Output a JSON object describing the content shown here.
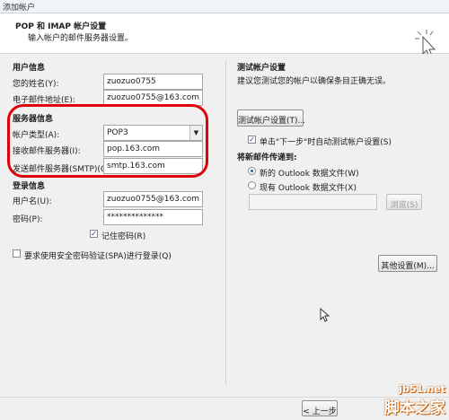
{
  "window": {
    "title": "添加帐户"
  },
  "header": {
    "title": "POP 和 IMAP 帐户设置",
    "subtitle": "输入帐户的邮件服务器设置。"
  },
  "user_info": {
    "heading": "用户信息",
    "name_label": "您的姓名(Y):",
    "name_value": "zuozuo0755",
    "email_label": "电子邮件地址(E):",
    "email_value": "zuozuo0755@163.com"
  },
  "server_info": {
    "heading": "服务器信息",
    "type_label": "帐户类型(A):",
    "type_value": "POP3",
    "incoming_label": "接收邮件服务器(I):",
    "incoming_value": "pop.163.com",
    "outgoing_label": "发送邮件服务器(SMTP)(O):",
    "outgoing_value": "smtp.163.com"
  },
  "login_info": {
    "heading": "登录信息",
    "user_label": "用户名(U):",
    "user_value": "zuozuo0755@163.com",
    "password_label": "密码(P):",
    "password_value": "**************",
    "remember_label": "记住密码(R)",
    "remember_checked": true
  },
  "spa": {
    "label": "要求使用安全密码验证(SPA)进行登录(Q)",
    "checked": false
  },
  "test": {
    "heading": "测试帐户设置",
    "desc": "建议您测试您的帐户以确保条目正确无误。",
    "button": "测试帐户设置(T)...",
    "auto_label": "单击\"下一步\"时自动测试帐户设置(S)",
    "auto_checked": true
  },
  "deliver": {
    "heading": "将新邮件传递到:",
    "new_label": "新的 Outlook 数据文件(W)",
    "existing_label": "现有 Outlook 数据文件(X)",
    "browse": "浏览(S)",
    "selected": "new"
  },
  "more_settings": "其他设置(M)...",
  "footer": {
    "back": "< 上一步"
  },
  "watermark": {
    "line1": "jb51.net",
    "line2": "脚本之家"
  },
  "colors": {
    "highlight_ring": "#e0000b",
    "panel": "#f0f0f0"
  }
}
